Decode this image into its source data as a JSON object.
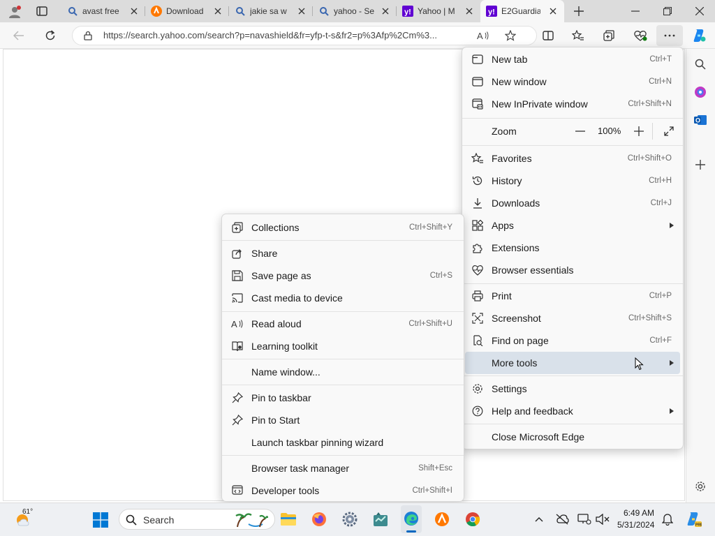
{
  "tabs": [
    {
      "title": "avast free",
      "favicon": "search-icon"
    },
    {
      "title": "Download",
      "favicon": "avast-logo"
    },
    {
      "title": "jakie sa w",
      "favicon": "search-icon"
    },
    {
      "title": "yahoo - Se",
      "favicon": "search-icon"
    },
    {
      "title": "Yahoo | M",
      "favicon": "yahoo-logo"
    },
    {
      "title": "E2Guardia",
      "favicon": "yahoo-logo",
      "active": true
    }
  ],
  "address": {
    "url": "https://search.yahoo.com/search?p=navashield&fr=yfp-t-s&fr2=p%3Afp%2Cm%3..."
  },
  "main_menu": {
    "items": [
      {
        "label": "New tab",
        "shortcut": "Ctrl+T",
        "icon": "new-tab-icon"
      },
      {
        "label": "New window",
        "shortcut": "Ctrl+N",
        "icon": "new-window-icon"
      },
      {
        "label": "New InPrivate window",
        "shortcut": "Ctrl+Shift+N",
        "icon": "inprivate-icon"
      },
      {
        "label": "Zoom",
        "value": "100%",
        "minus": "—",
        "plus": "+"
      },
      {
        "label": "Favorites",
        "shortcut": "Ctrl+Shift+O",
        "icon": "favorites-icon"
      },
      {
        "label": "History",
        "shortcut": "Ctrl+H",
        "icon": "history-icon"
      },
      {
        "label": "Downloads",
        "shortcut": "Ctrl+J",
        "icon": "download-icon"
      },
      {
        "label": "Apps",
        "icon": "apps-icon"
      },
      {
        "label": "Extensions",
        "icon": "extensions-icon"
      },
      {
        "label": "Browser essentials",
        "icon": "heart-pulse-icon"
      },
      {
        "label": "Print",
        "shortcut": "Ctrl+P",
        "icon": "print-icon"
      },
      {
        "label": "Screenshot",
        "shortcut": "Ctrl+Shift+S",
        "icon": "screenshot-icon"
      },
      {
        "label": "Find on page",
        "shortcut": "Ctrl+F",
        "icon": "find-icon"
      },
      {
        "label": "More tools",
        "icon": "none"
      },
      {
        "label": "Settings",
        "icon": "gear-icon"
      },
      {
        "label": "Help and feedback",
        "icon": "help-icon"
      },
      {
        "label": "Close Microsoft Edge",
        "icon": "none"
      }
    ]
  },
  "more_tools_menu": {
    "items": [
      {
        "label": "Collections",
        "shortcut": "Ctrl+Shift+Y",
        "icon": "collections-icon"
      },
      {
        "label": "Share",
        "icon": "share-icon"
      },
      {
        "label": "Save page as",
        "shortcut": "Ctrl+S",
        "icon": "save-icon"
      },
      {
        "label": "Cast media to device",
        "icon": "cast-icon"
      },
      {
        "label": "Read aloud",
        "shortcut": "Ctrl+Shift+U",
        "icon": "read-aloud-icon"
      },
      {
        "label": "Learning toolkit",
        "icon": "learning-toolkit-icon"
      },
      {
        "label": "Name window...",
        "icon": "none"
      },
      {
        "label": "Pin to taskbar",
        "icon": "pin-icon"
      },
      {
        "label": "Pin to Start",
        "icon": "pin-icon"
      },
      {
        "label": "Launch taskbar pinning wizard",
        "icon": "none"
      },
      {
        "label": "Browser task manager",
        "shortcut": "Shift+Esc",
        "icon": "none"
      },
      {
        "label": "Developer tools",
        "shortcut": "Ctrl+Shift+I",
        "icon": "developer-tools-icon"
      }
    ]
  },
  "taskbar": {
    "weather": "61°",
    "search_placeholder": "Search",
    "time": "6:49 AM",
    "date": "5/31/2024"
  },
  "colors": {
    "accent": "#0067c0",
    "menu_highlight": "#d9e1ea",
    "tab_bar": "#dcdcdc",
    "yahoo_purple": "#6001d2",
    "avast_orange": "#ff7800"
  }
}
